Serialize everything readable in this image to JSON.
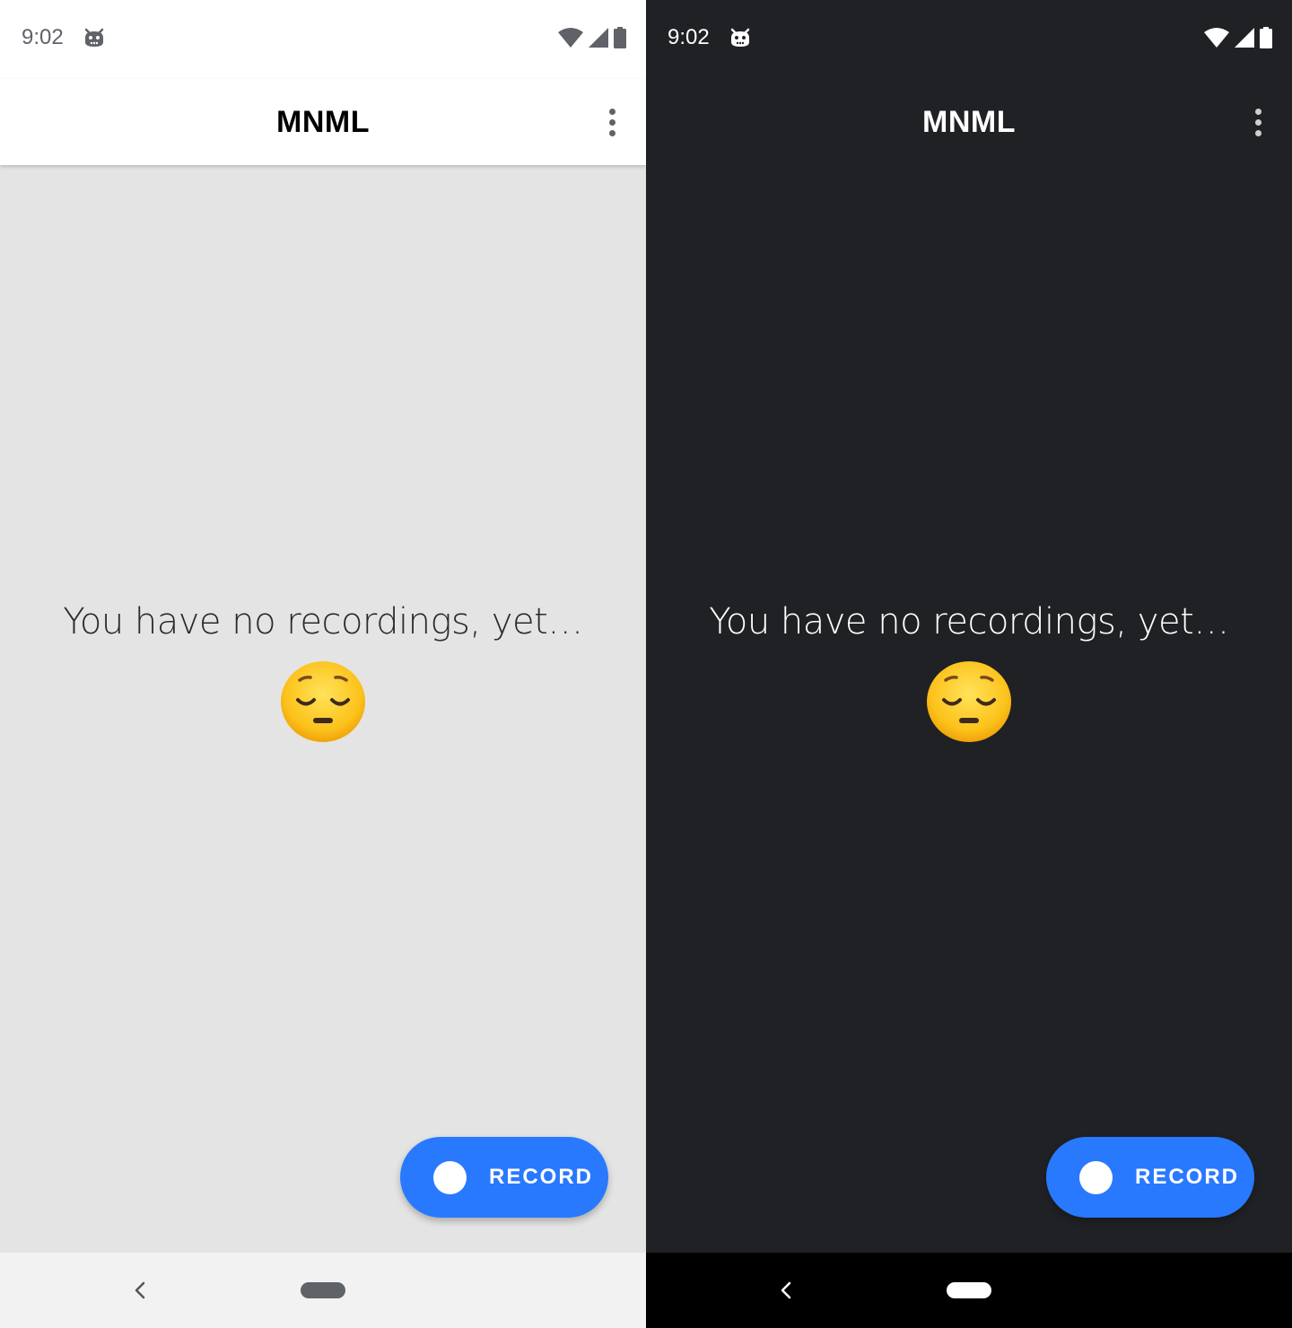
{
  "colors": {
    "accent": "#2979ff",
    "light_background": "#e4e4e4",
    "dark_background": "#202124"
  },
  "screens": [
    {
      "theme": "light",
      "status_bar": {
        "time": "9:02",
        "app_icon": "robot-icon",
        "icons": [
          "wifi-icon",
          "cellular-signal-icon",
          "battery-icon"
        ]
      },
      "app_bar": {
        "title": "MNML",
        "menu_icon": "more-vert-icon"
      },
      "empty_state": {
        "message": "You have no recordings, yet…",
        "emoji": "pensive-face-emoji"
      },
      "fab": {
        "label": "RECORD",
        "icon": "record-dot-icon"
      },
      "nav_bar": {
        "back_icon": "back-chevron-icon",
        "home_icon": "home-pill-icon"
      }
    },
    {
      "theme": "dark",
      "status_bar": {
        "time": "9:02",
        "app_icon": "robot-icon",
        "icons": [
          "wifi-icon",
          "cellular-signal-icon",
          "battery-icon"
        ]
      },
      "app_bar": {
        "title": "MNML",
        "menu_icon": "more-vert-icon"
      },
      "empty_state": {
        "message": "You have no recordings, yet…",
        "emoji": "pensive-face-emoji"
      },
      "fab": {
        "label": "RECORD",
        "icon": "record-dot-icon"
      },
      "nav_bar": {
        "back_icon": "back-chevron-icon",
        "home_icon": "home-pill-icon"
      }
    }
  ]
}
